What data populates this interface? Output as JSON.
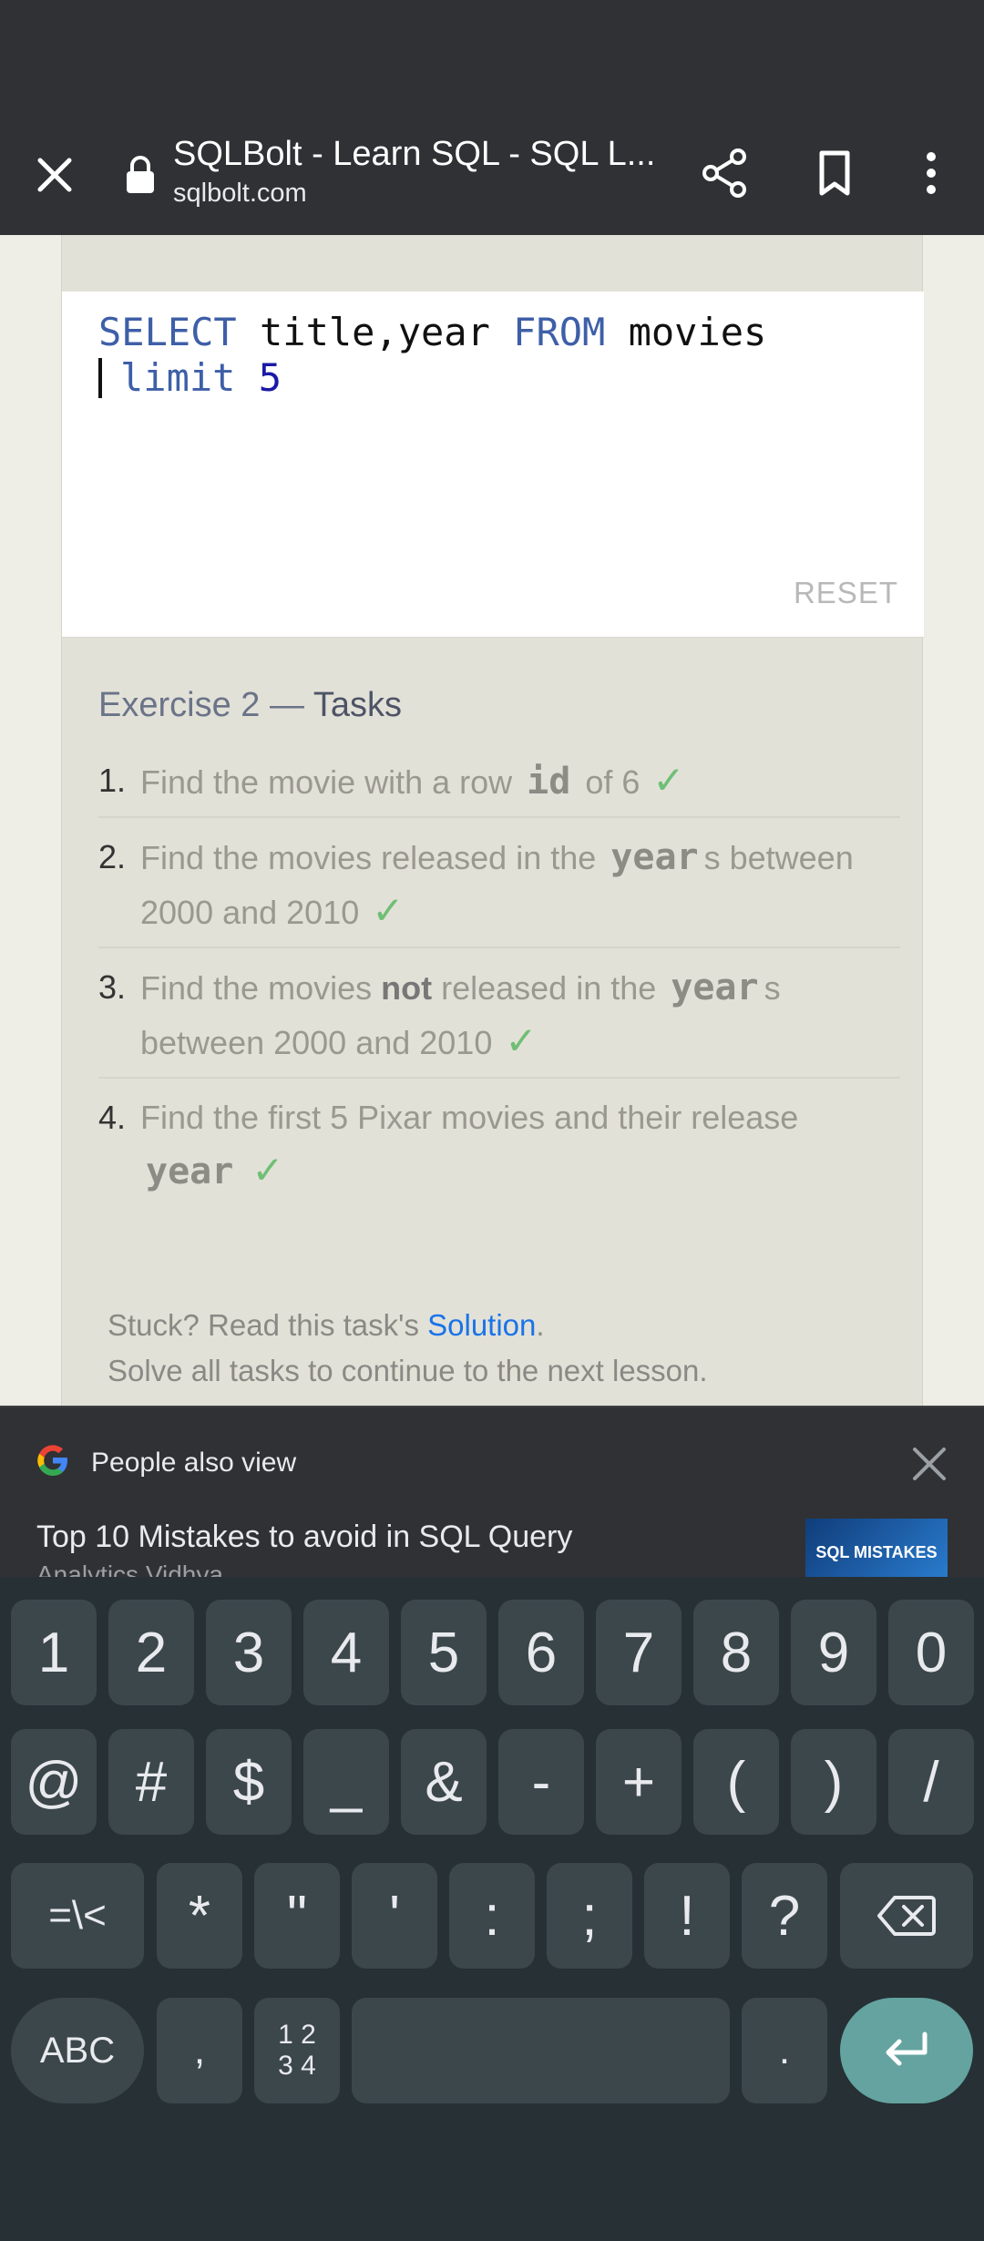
{
  "browser": {
    "title": "SQLBolt - Learn SQL - SQL L...",
    "url": "sqlbolt.com"
  },
  "editor": {
    "line1": {
      "kw1": "SELECT",
      "mid": " title,year ",
      "kw2": "FROM",
      "end": " movies"
    },
    "line2": {
      "kw": "limit",
      "num": "5"
    },
    "reset_label": "RESET"
  },
  "exercise": {
    "title_prefix": "Exercise 2 —",
    "title_strong": "Tasks",
    "tasks": [
      {
        "num": "1.",
        "parts": [
          "Find the movie with a row ",
          "id",
          " of 6"
        ],
        "done": "✓"
      },
      {
        "num": "2.",
        "parts": [
          "Find the movies released in the ",
          "year",
          "s between 2000 and 2010"
        ],
        "done": "✓"
      },
      {
        "num": "3.",
        "pre": "Find the movies ",
        "bold": "not",
        "post": " released in the ",
        "code": "year",
        "tail": "s between 2000 and 2010",
        "done": "✓"
      },
      {
        "num": "4.",
        "parts": [
          "Find the first 5 Pixar movies and their release ",
          "year",
          ""
        ],
        "done": "✓"
      }
    ],
    "footer_line1_pre": "Stuck? Read this task's ",
    "footer_link": "Solution",
    "footer_line1_post": ".",
    "footer_line2": "Solve all tasks to continue to the next lesson."
  },
  "suggestions": {
    "header": "People also view",
    "item_title": "Top 10 Mistakes to avoid in SQL Query",
    "item_source": "Analytics Vidhya",
    "thumb_text": "SQL MISTAKES"
  },
  "keyboard": {
    "row1": [
      "1",
      "2",
      "3",
      "4",
      "5",
      "6",
      "7",
      "8",
      "9",
      "0"
    ],
    "row2": [
      "@",
      "#",
      "$",
      "_",
      "&",
      "-",
      "+",
      "(",
      ")",
      "/"
    ],
    "row3": [
      "=\\<",
      "*",
      "\"",
      "'",
      ":",
      ";",
      "!",
      "?"
    ],
    "abc": "ABC",
    "comma": ",",
    "sym_top": "1 2",
    "sym_bottom": "3 4",
    "period": "."
  },
  "colors": {
    "accent_check": "#6fbf75",
    "link": "#1a73e8",
    "enter_key": "#64a3a0"
  }
}
